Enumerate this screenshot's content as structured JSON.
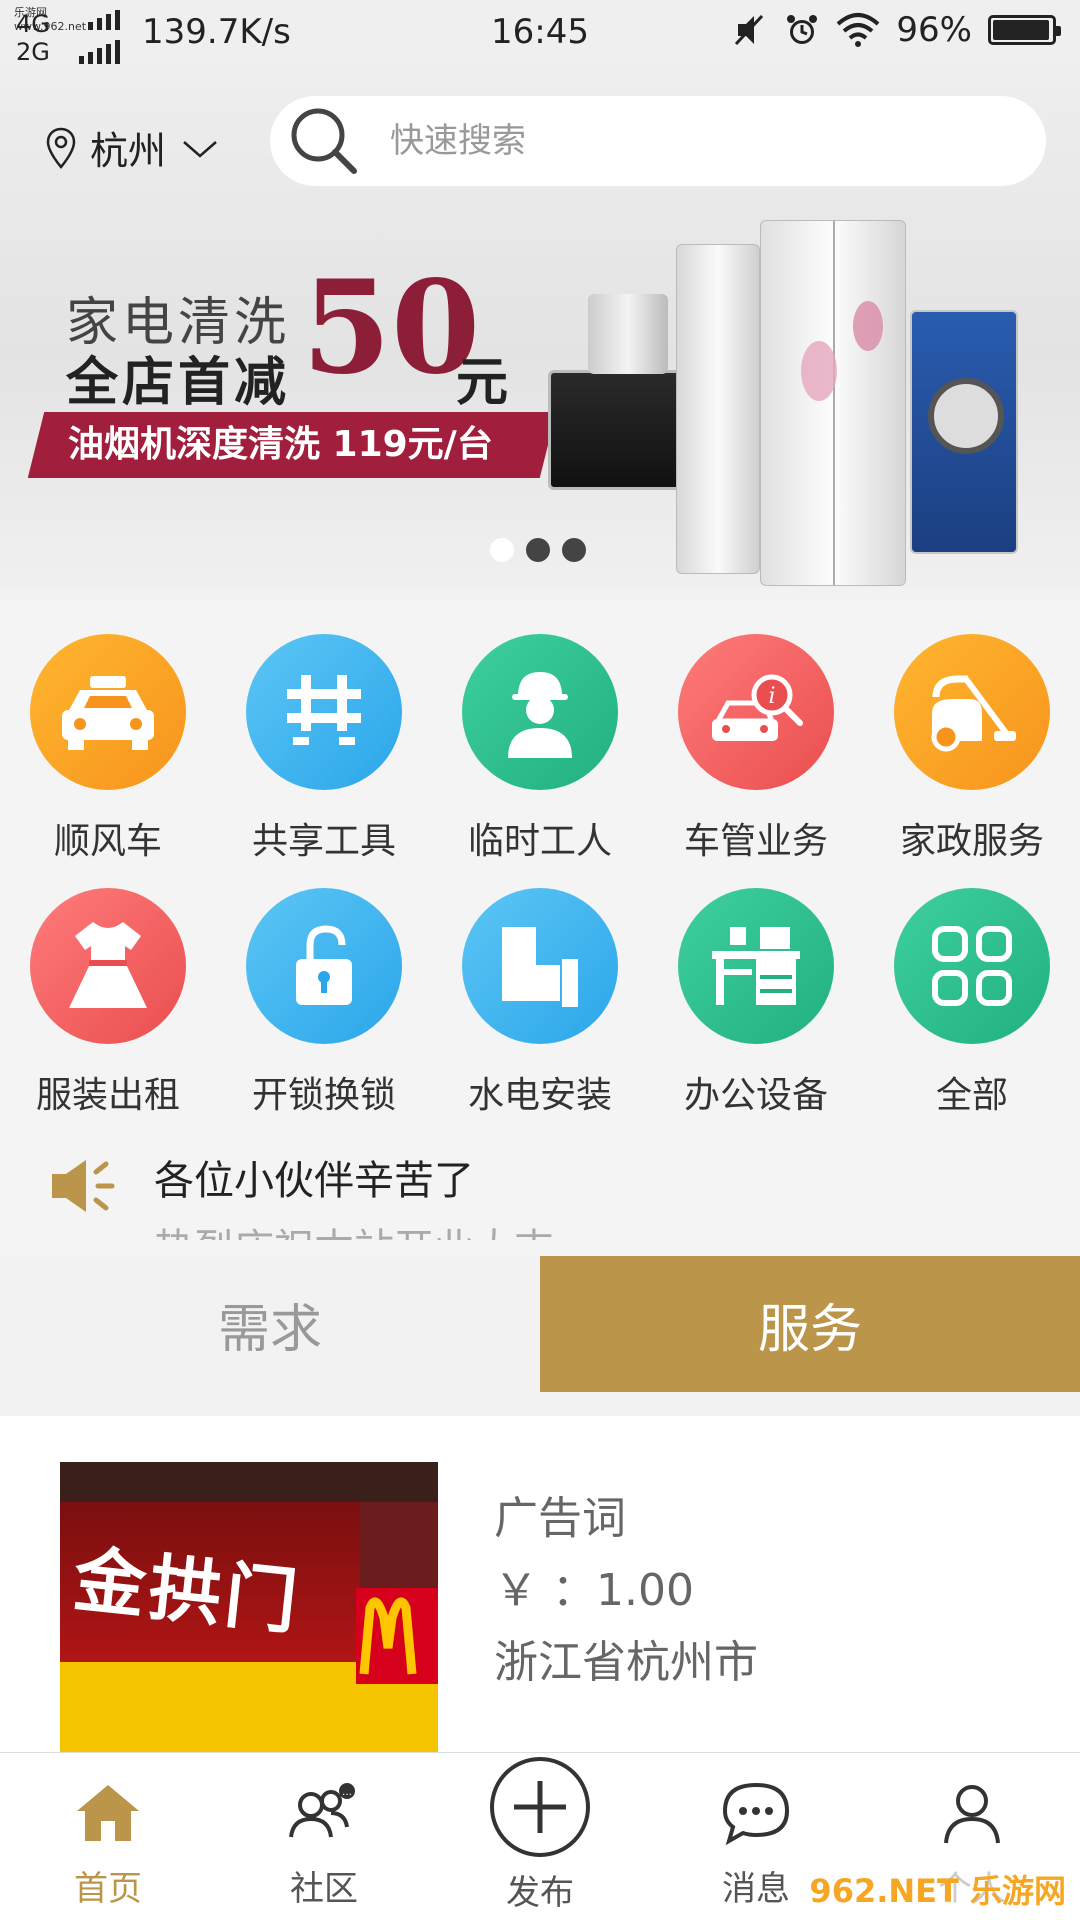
{
  "status_bar": {
    "site_mark": "乐游网 www.962.net",
    "net_type_1": "4G",
    "net_type_2": "2G",
    "speed": "139.7K/s",
    "time": "16:45",
    "battery": "96%",
    "battery_level": 0.96,
    "icons": [
      "mute-icon",
      "alarm-icon",
      "wifi-icon",
      "battery-icon"
    ]
  },
  "header": {
    "city": "杭州",
    "search_placeholder": "快速搜索"
  },
  "banner": {
    "line1": "家电清洗",
    "line2": "全店首减",
    "amount": "50",
    "unit": "元",
    "tag": "油烟机深度清洗 119元/台",
    "dots": 3,
    "active_dot": 0
  },
  "categories": [
    {
      "label": "顺风车",
      "icon": "taxi-icon",
      "color": "#f9a21a"
    },
    {
      "label": "共享工具",
      "icon": "tools-icon",
      "color": "#3fb2ee"
    },
    {
      "label": "临时工人",
      "icon": "worker-icon",
      "color": "#2fc08e"
    },
    {
      "label": "车管业务",
      "icon": "car-service-icon",
      "color": "#f05a5a"
    },
    {
      "label": "家政服务",
      "icon": "vacuum-icon",
      "color": "#f9a21a"
    },
    {
      "label": "服装出租",
      "icon": "dress-icon",
      "color": "#f05a5a"
    },
    {
      "label": "开锁换锁",
      "icon": "unlock-icon",
      "color": "#3fb2ee"
    },
    {
      "label": "水电安装",
      "icon": "pipe-icon",
      "color": "#3fb2ee"
    },
    {
      "label": "办公设备",
      "icon": "desk-icon",
      "color": "#2fc08e"
    },
    {
      "label": "全部",
      "icon": "grid-icon",
      "color": "#2fc08e"
    }
  ],
  "notice": {
    "text": "各位小伙伴辛苦了",
    "next_text": "热烈庆祝本站开业大吉"
  },
  "tabs": [
    {
      "label": "需求",
      "active": false
    },
    {
      "label": "服务",
      "active": true
    }
  ],
  "listing": {
    "sign_text": "金拱门",
    "title": "广告词",
    "price": "￥ ：1.00",
    "location": "浙江省杭州市"
  },
  "bottom_nav": [
    {
      "label": "首页",
      "icon": "home-icon",
      "active": true
    },
    {
      "label": "社区",
      "icon": "community-icon",
      "active": false
    },
    {
      "label": "发布",
      "icon": "plus-icon",
      "active": false
    },
    {
      "label": "消息",
      "icon": "message-icon",
      "active": false
    },
    {
      "label": "个人",
      "icon": "person-icon",
      "active": false
    }
  ],
  "watermark": "962.NET 乐游网",
  "colors": {
    "accent": "#bb954a",
    "promo_red": "#a11f3d"
  }
}
